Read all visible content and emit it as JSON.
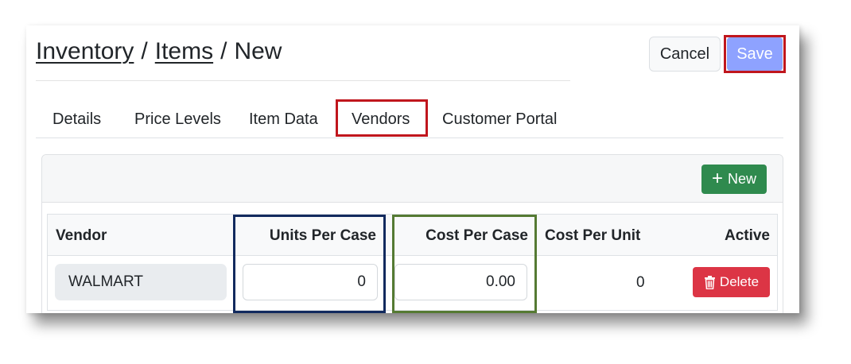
{
  "breadcrumb": {
    "inventory": "Inventory",
    "items": "Items",
    "current": "New",
    "separator": "/"
  },
  "header": {
    "cancel_label": "Cancel",
    "save_label": "Save"
  },
  "tabs": [
    {
      "label": "Details"
    },
    {
      "label": "Price Levels"
    },
    {
      "label": "Item Data"
    },
    {
      "label": "Vendors"
    },
    {
      "label": "Customer Portal"
    }
  ],
  "active_tab": "Vendors",
  "vendors": {
    "new_label": "New",
    "new_icon": "plus-icon",
    "columns": [
      "Vendor",
      "Units Per Case",
      "Cost Per Case",
      "Cost Per Unit",
      "Active"
    ],
    "rows": [
      {
        "vendor": "WALMART",
        "units_per_case": "0",
        "cost_per_case": "0.00",
        "cost_per_unit": "0",
        "delete_label": "Delete",
        "delete_icon": "trash-icon"
      }
    ]
  },
  "colors": {
    "save": "#8ea2ff",
    "new": "#2f8a4e",
    "delete": "#dc3545",
    "highlight_red": "#c0161d",
    "highlight_blue": "#122a5e",
    "highlight_green": "#557a33"
  }
}
